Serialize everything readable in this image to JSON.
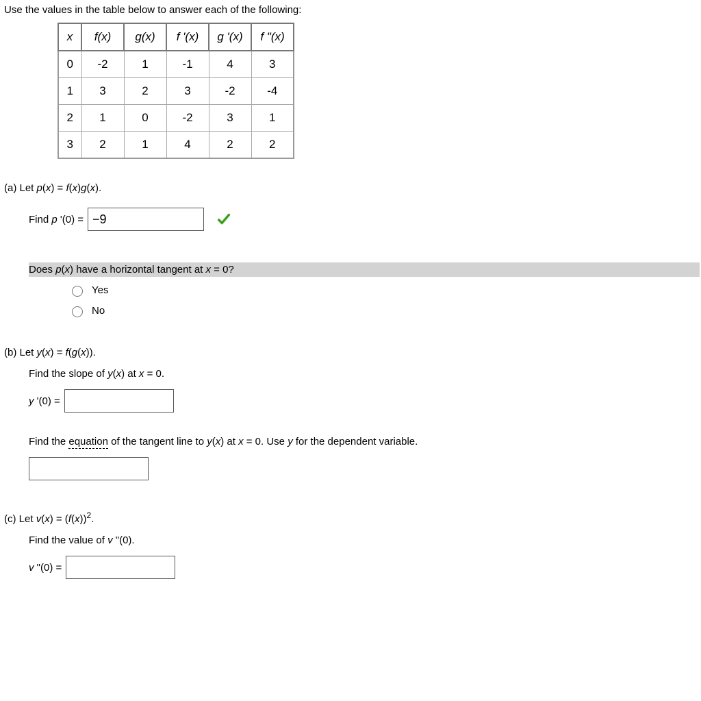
{
  "intro": "Use the values in the table below to answer each of the following:",
  "table": {
    "headers": [
      "x",
      "f(x)",
      "g(x)",
      "f '(x)",
      "g '(x)",
      "f \"(x)"
    ],
    "rows": [
      [
        "0",
        "-2",
        "1",
        "-1",
        "4",
        "3"
      ],
      [
        "1",
        "3",
        "2",
        "3",
        "-2",
        "-4"
      ],
      [
        "2",
        "1",
        "0",
        "-2",
        "3",
        "1"
      ],
      [
        "3",
        "2",
        "1",
        "4",
        "2",
        "2"
      ]
    ]
  },
  "a": {
    "label": "(a) Let p(x) = f(x)g(x).",
    "find_prefix": "Find p '(0) = ",
    "answer": "−9",
    "q2": "Does p(x) have a horizontal tangent at x = 0?",
    "opt_yes": "Yes",
    "opt_no": "No"
  },
  "b": {
    "label": "(b) Let y(x) = f(g(x)).",
    "slope": "Find the slope of y(x) at x = 0.",
    "yprime": "y '(0) = ",
    "tangent_pre": "Find the ",
    "tangent_eq": "equation",
    "tangent_post": " of the tangent line to y(x) at x = 0. Use y for the dependent variable."
  },
  "c": {
    "label_pre": "(c) Let v(x) = (f(x))",
    "label_sup": "2",
    "label_post": ".",
    "find": "Find the value of v \"(0).",
    "vdd": "v \"(0) = "
  }
}
